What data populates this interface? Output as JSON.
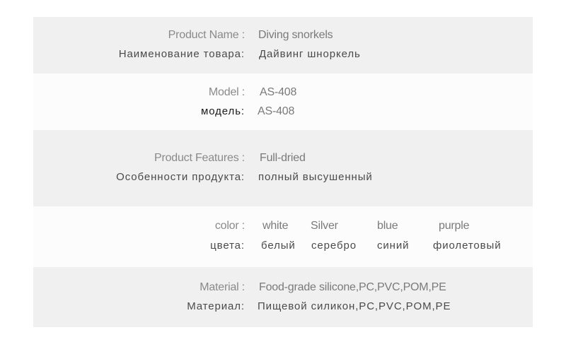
{
  "rows": [
    {
      "en_label": "Product Name :",
      "en_value": "Diving snorkels",
      "ru_label": "Наименование товара:",
      "ru_value": "Дайвинг шноркель"
    },
    {
      "en_label": "Model :",
      "en_value": "AS-408",
      "ru_label": "модель:",
      "ru_value": "AS-408"
    },
    {
      "en_label": "Product Features :",
      "en_value": "Full-dried",
      "ru_label": "Особенности продукта:",
      "ru_value": "полный высушенный"
    },
    {
      "en_label": "color :",
      "en_values": [
        "white",
        "Silver",
        "blue",
        "purple"
      ],
      "ru_label": "цвета:",
      "ru_values": [
        "белый",
        "серебро",
        "синий",
        "фиолетовый"
      ]
    },
    {
      "en_label": "Material :",
      "en_value": "Food-grade silicone,PC,PVC,POM,PE",
      "ru_label": "Материал:",
      "ru_value": "Пищевой силикон,PC,PVC,POM,PE"
    }
  ],
  "colors": {
    "band_gray": "#f0f0f0",
    "band_light": "#fcfcfc"
  }
}
